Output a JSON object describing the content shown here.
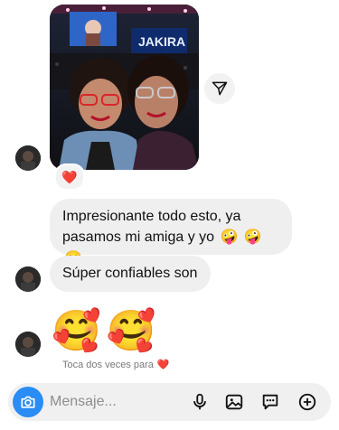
{
  "chat": {
    "shared_photo": {
      "screen_text": "JAKIRA",
      "reaction": "❤️"
    },
    "messages": [
      {
        "text": "Impresionante todo esto, ya pasamos mi amiga y yo",
        "emojis": [
          "🤪",
          "🤪",
          "😊"
        ]
      },
      {
        "text": "Súper confiables son"
      }
    ],
    "big_emojis": [
      "🥰",
      "🥰"
    ],
    "hint": {
      "text": "Toca dos veces para",
      "emoji": "❤️"
    }
  },
  "composer": {
    "placeholder": "Mensaje...",
    "icons": [
      "camera-icon",
      "microphone-icon",
      "gallery-icon",
      "sticker-icon",
      "plus-icon"
    ],
    "accent_color": "#2a8cf5"
  }
}
